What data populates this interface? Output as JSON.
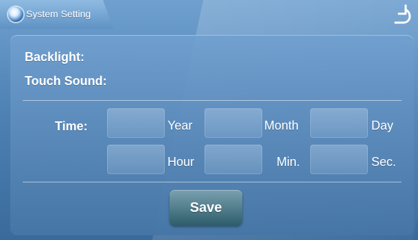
{
  "header": {
    "title": "System Setting",
    "icon": "gear-icon",
    "back_icon": "return-icon"
  },
  "settings": {
    "backlight_label": "Backlight:",
    "touch_sound_label": "Touch Sound:"
  },
  "time": {
    "label": "Time:",
    "units_row1": [
      "Year",
      "Month",
      "Day"
    ],
    "units_row2": [
      "Hour",
      "Min.",
      "Sec."
    ]
  },
  "actions": {
    "save_label": "Save"
  },
  "colors": {
    "background": "#4f82b5",
    "panel": "#5f92c4",
    "text": "#ffffff",
    "button_top": "#7aa0b0",
    "button_bottom": "#2d5d6a"
  }
}
